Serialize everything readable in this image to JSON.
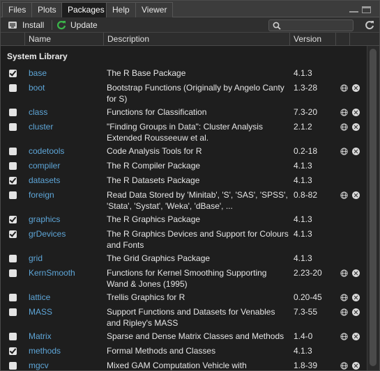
{
  "tabs": [
    {
      "label": "Files",
      "active": false
    },
    {
      "label": "Plots",
      "active": false
    },
    {
      "label": "Packages",
      "active": true
    },
    {
      "label": "Help",
      "active": false
    },
    {
      "label": "Viewer",
      "active": false
    }
  ],
  "toolbar": {
    "install_label": "Install",
    "update_label": "Update",
    "search_placeholder": "",
    "accent_green": "#3bb54a"
  },
  "columns": {
    "name": "Name",
    "description": "Description",
    "version": "Version"
  },
  "group_title": "System Library",
  "packages": [
    {
      "name": "base",
      "checked": true,
      "desc": "The R Base Package",
      "version": "4.1.3",
      "actions": false
    },
    {
      "name": "boot",
      "checked": false,
      "desc": "Bootstrap Functions (Originally by Angelo Canty for S)",
      "version": "1.3-28",
      "actions": true
    },
    {
      "name": "class",
      "checked": false,
      "desc": "Functions for Classification",
      "version": "7.3-20",
      "actions": true
    },
    {
      "name": "cluster",
      "checked": false,
      "desc": "\"Finding Groups in Data\": Cluster Analysis Extended Rousseeuw et al.",
      "version": "2.1.2",
      "actions": true
    },
    {
      "name": "codetools",
      "checked": false,
      "desc": "Code Analysis Tools for R",
      "version": "0.2-18",
      "actions": true
    },
    {
      "name": "compiler",
      "checked": false,
      "desc": "The R Compiler Package",
      "version": "4.1.3",
      "actions": false
    },
    {
      "name": "datasets",
      "checked": true,
      "desc": "The R Datasets Package",
      "version": "4.1.3",
      "actions": false
    },
    {
      "name": "foreign",
      "checked": false,
      "desc": "Read Data Stored by 'Minitab', 'S', 'SAS', 'SPSS', 'Stata', 'Systat', 'Weka', 'dBase', ...",
      "version": "0.8-82",
      "actions": true
    },
    {
      "name": "graphics",
      "checked": true,
      "desc": "The R Graphics Package",
      "version": "4.1.3",
      "actions": false
    },
    {
      "name": "grDevices",
      "checked": true,
      "desc": "The R Graphics Devices and Support for Colours and Fonts",
      "version": "4.1.3",
      "actions": false
    },
    {
      "name": "grid",
      "checked": false,
      "desc": "The Grid Graphics Package",
      "version": "4.1.3",
      "actions": false
    },
    {
      "name": "KernSmooth",
      "checked": false,
      "desc": "Functions for Kernel Smoothing Supporting Wand & Jones (1995)",
      "version": "2.23-20",
      "actions": true
    },
    {
      "name": "lattice",
      "checked": false,
      "desc": "Trellis Graphics for R",
      "version": "0.20-45",
      "actions": true
    },
    {
      "name": "MASS",
      "checked": false,
      "desc": "Support Functions and Datasets for Venables and Ripley's MASS",
      "version": "7.3-55",
      "actions": true
    },
    {
      "name": "Matrix",
      "checked": false,
      "desc": "Sparse and Dense Matrix Classes and Methods",
      "version": "1.4-0",
      "actions": true
    },
    {
      "name": "methods",
      "checked": true,
      "desc": "Formal Methods and Classes",
      "version": "4.1.3",
      "actions": false
    },
    {
      "name": "mgcv",
      "checked": false,
      "desc": "Mixed GAM Computation Vehicle with",
      "version": "1.8-39",
      "actions": true
    }
  ]
}
